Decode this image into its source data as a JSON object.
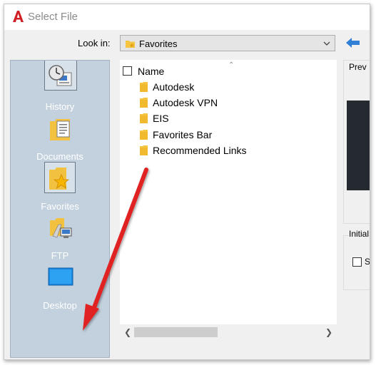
{
  "window": {
    "title": "Select File",
    "app_icon": "autocad-a-icon"
  },
  "lookin": {
    "label": "Look in:",
    "value": "Favorites"
  },
  "places": [
    {
      "label": "History",
      "icon": "history-icon"
    },
    {
      "label": "Documents",
      "icon": "documents-icon"
    },
    {
      "label": "Favorites",
      "icon": "favorites-icon",
      "selected": true
    },
    {
      "label": "FTP",
      "icon": "ftp-icon"
    },
    {
      "label": "Desktop",
      "icon": "desktop-icon"
    }
  ],
  "filelist": {
    "column_header": "Name",
    "items": [
      {
        "name": "Autodesk"
      },
      {
        "name": "Autodesk VPN"
      },
      {
        "name": "EIS"
      },
      {
        "name": "Favorites Bar"
      },
      {
        "name": "Recommended Links"
      }
    ]
  },
  "preview": {
    "label": "Prev"
  },
  "initial_view": {
    "label": "Initial",
    "checkbox_label": "S"
  },
  "colors": {
    "places_bg": "#c3d1de",
    "folder": "#f5c542",
    "annotation_arrow": "#e02020",
    "back_arrow": "#2f7fd6"
  }
}
